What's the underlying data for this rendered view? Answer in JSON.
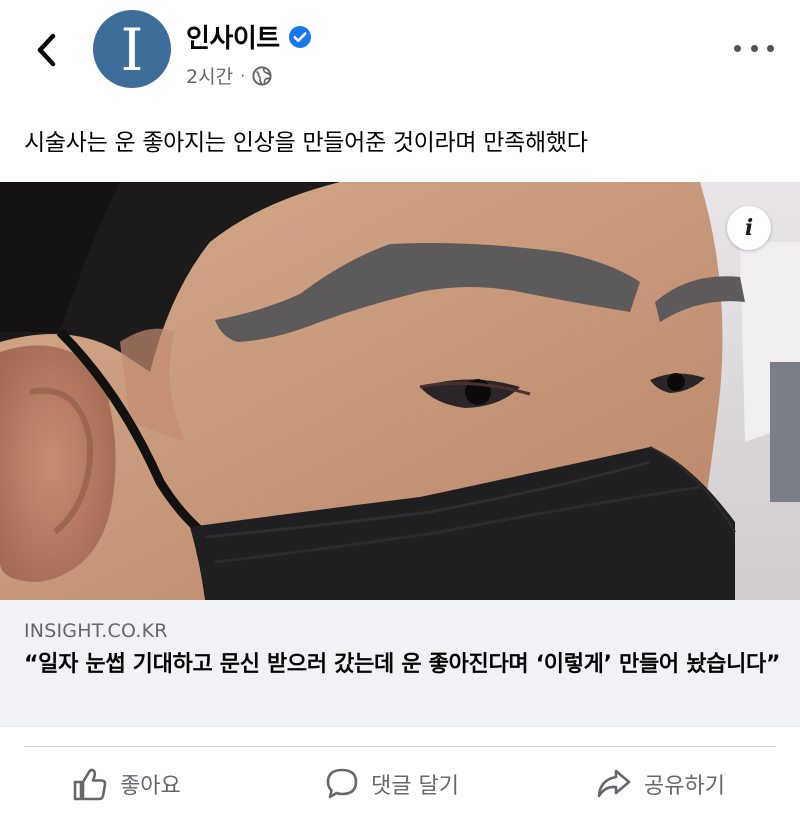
{
  "header": {
    "page_name": "인사이트",
    "avatar_letter": "I",
    "time": "2시간",
    "separator": "·",
    "icons": {
      "back": "chevron-left-icon",
      "verified": "verified-badge-icon",
      "audience": "globe-icon",
      "more": "more-horizontal-icon"
    }
  },
  "post": {
    "text": "시술사는 운 좋아지는 인상을 만들어준 것이라며 만족해했다"
  },
  "link": {
    "info_label": "i",
    "domain": "INSIGHT.CO.KR",
    "title": "“일자 눈썹 기대하고 문신 받으러 갔는데 운 좋아진다며 ‘이렇게’ 만들어 놨습니다”"
  },
  "actions": {
    "like": "좋아요",
    "comment": "댓글 달기",
    "share": "공유하기"
  },
  "colors": {
    "avatar_bg": "#3d6d99",
    "verified": "#1877f2",
    "secondary_text": "#65676b",
    "link_preview_bg": "#f0f2f5"
  }
}
